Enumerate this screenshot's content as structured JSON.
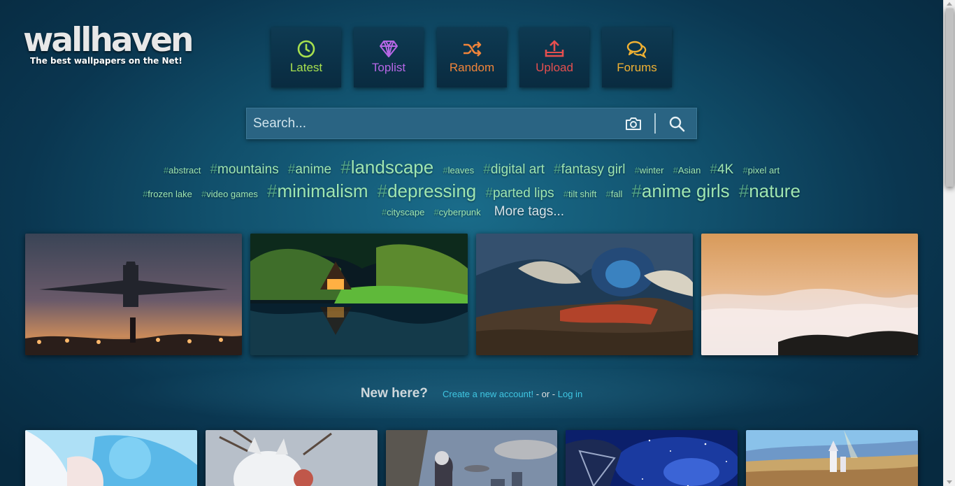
{
  "logo": {
    "name": "wallhaven",
    "tagline": "The best wallpapers on the Net!"
  },
  "nav": [
    {
      "label": "Latest",
      "icon": "clock-icon",
      "color": "#a7e04e"
    },
    {
      "label": "Toplist",
      "icon": "diamond-icon",
      "color": "#b767e6"
    },
    {
      "label": "Random",
      "icon": "shuffle-icon",
      "color": "#f0843a"
    },
    {
      "label": "Upload",
      "icon": "upload-icon",
      "color": "#e54f4f"
    },
    {
      "label": "Forums",
      "icon": "chat-icon",
      "color": "#f2b233"
    }
  ],
  "search": {
    "placeholder": "Search...",
    "camera_icon": "camera-icon",
    "search_icon": "search-icon"
  },
  "tags": {
    "row1": [
      "abstract",
      "mountains",
      "anime",
      "landscape",
      "leaves",
      "digital art",
      "fantasy girl",
      "winter",
      "Asian",
      "4K",
      "pixel art"
    ],
    "row2": [
      "frozen lake",
      "video games",
      "minimalism",
      "depressing",
      "parted lips",
      "tilt shift",
      "fall",
      "anime girls",
      "nature"
    ],
    "row3": [
      "cityscape",
      "cyberpunk"
    ],
    "more_label": "More tags..."
  },
  "featured_thumbnails": [
    "airplane-landing-girl",
    "cabin-by-lake-night",
    "fantasy-sky-landscape",
    "sea-of-clouds-sunset"
  ],
  "new_here": {
    "question": "New here?",
    "create_link": "Create a new account!",
    "or_text": " - or - ",
    "login_link": "Log in"
  },
  "bottom_thumbnails": [
    "anime-couple-blue",
    "white-fox-girl",
    "airship-city",
    "radio-telescope-stars",
    "fantasy-castle-city"
  ],
  "colors": {
    "accent": "#3fc6e2",
    "tag": "#9fe6b2",
    "bg": "#11506c"
  }
}
